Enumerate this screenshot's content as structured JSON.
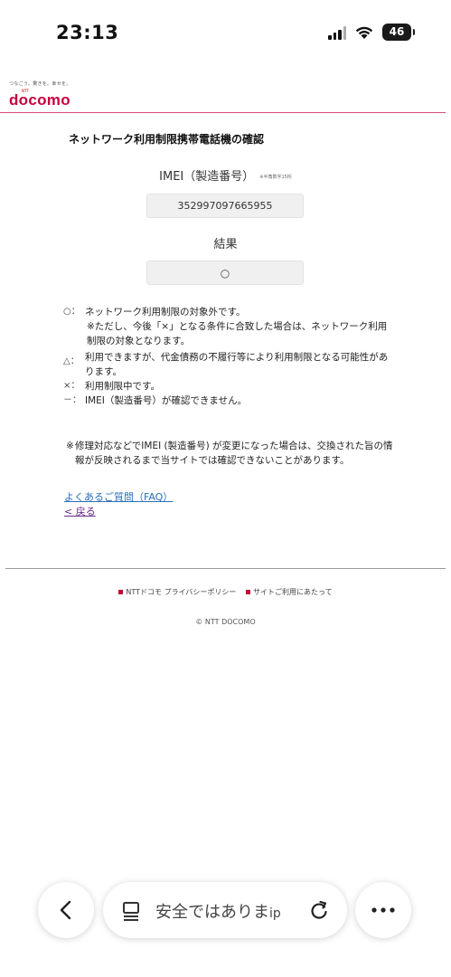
{
  "status_bar": {
    "time": "23:13",
    "battery": "46"
  },
  "header": {
    "tagline": "つなごう。驚きを。幸せを。",
    "ntt": "NTT",
    "logo_text": "docomo"
  },
  "main": {
    "title": "ネットワーク利用制限携帯電話機の確認",
    "imei_label": "IMEI（製造番号）",
    "imei_note": "※半角数字15桁",
    "imei_value": "352997097665955",
    "result_label": "結果",
    "result_value": "○"
  },
  "legend": [
    {
      "mark": "○：",
      "text": "ネットワーク利用制限の対象外です。"
    },
    {
      "mark": "",
      "text": "※ただし、今後「×」となる条件に合致した場合は、ネットワーク利用制限の対象となります。"
    },
    {
      "mark": "△：",
      "text": "利用できますが、代金債務の不履行等により利用制限となる可能性があります。"
    },
    {
      "mark": "×：",
      "text": "利用制限中です。"
    },
    {
      "mark": "－：",
      "text": "IMEI（製造番号）が確認できません。"
    }
  ],
  "footnote": {
    "mark": "※",
    "text": "修理対応などでIMEI (製造番号) が変更になった場合は、交換された旨の情報が反映されるまで当サイトでは確認できないことがあります。"
  },
  "links": {
    "faq": "よくあるご質問（FAQ）",
    "back": "< 戻る"
  },
  "footer": {
    "privacy": "NTTドコモ プライバシーポリシー",
    "terms": "サイトご利用にあたって",
    "copyright": "© NTT DOCOMO"
  },
  "browser": {
    "address_text": "安全ではありま",
    "address_suffix": "ip"
  },
  "colors": {
    "brand": "#c5003e",
    "link": "#2a6ebb",
    "visited": "#6a2a8a"
  }
}
